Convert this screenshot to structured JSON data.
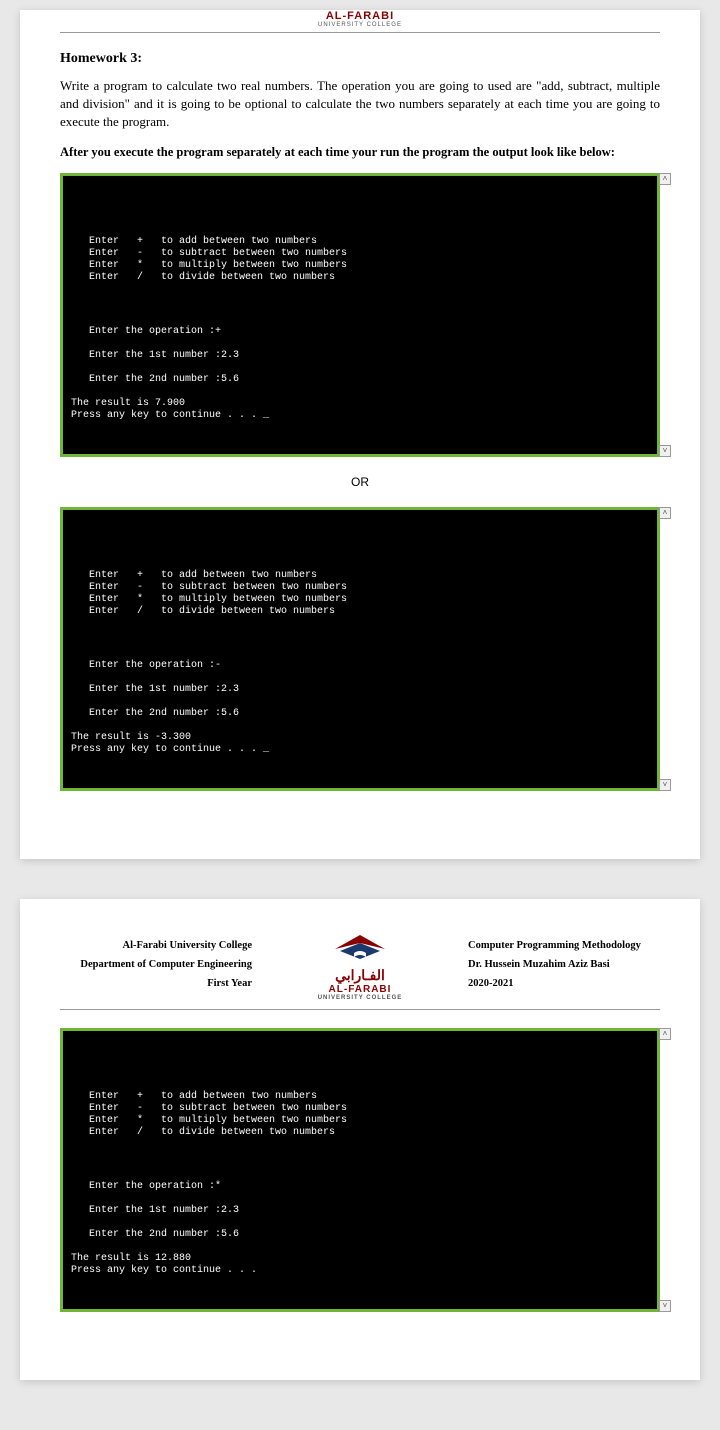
{
  "college": {
    "name_en": "AL-FARABI",
    "subtitle": "UNIVERSITY COLLEGE",
    "name_ar": "الفـارابي"
  },
  "page1": {
    "hw_title": "Homework 3:",
    "hw_text": "Write a program to calculate two real numbers. The operation you are going to used are \"add, subtract, multiple and division\" and it is going to be optional to calculate the two numbers separately at each time you are going to execute the program.",
    "hw_bold": "After you execute the program separately at each time your run the program the output look like below:",
    "or": "OR"
  },
  "menu": {
    "l1": "Enter   +   to add between two numbers",
    "l2": "Enter   -   to subtract between two numbers",
    "l3": "Enter   *   to multiply between two numbers",
    "l4": "Enter   /   to divide between two numbers"
  },
  "run1": {
    "op": "Enter the operation :+",
    "n1": "Enter the 1st number :2.3",
    "n2": "Enter the 2nd number :5.6",
    "res": "The result is 7.900",
    "cont": "Press any key to continue . . . _"
  },
  "run2": {
    "op": "Enter the operation :-",
    "n1": "Enter the 1st number :2.3",
    "n2": "Enter the 2nd number :5.6",
    "res": "The result is -3.300",
    "cont": "Press any key to continue . . . _"
  },
  "run3": {
    "op": "Enter the operation :*",
    "n1": "Enter the 1st number :2.3",
    "n2": "Enter the 2nd number :5.6",
    "res": "The result is 12.880",
    "cont": "Press any key to continue . . ."
  },
  "page2": {
    "left1": "Al-Farabi University College",
    "left2": "Department of Computer Engineering",
    "left3": "First Year",
    "right1": "Computer Programming Methodology",
    "right2": "Dr. Hussein Muzahim Aziz Basi",
    "right3": "2020-2021"
  },
  "scroll": {
    "up": "˄",
    "down": "˅"
  }
}
